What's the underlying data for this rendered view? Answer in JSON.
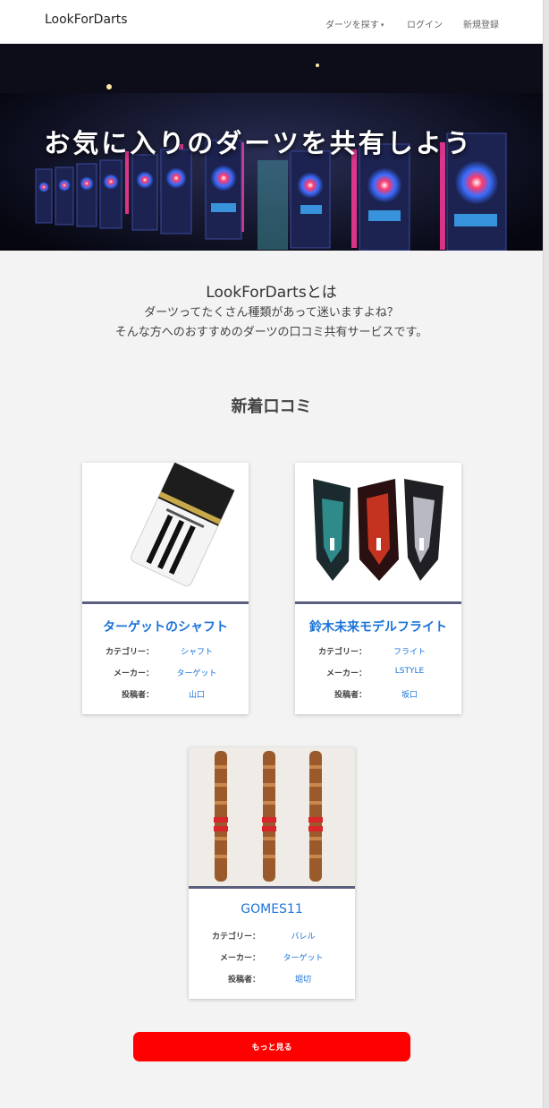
{
  "header": {
    "brand": "LookForDarts",
    "nav": {
      "search": "ダーツを探す",
      "login": "ログイン",
      "signup": "新規登録"
    }
  },
  "hero": {
    "title": "お気に入りのダーツを共有しよう"
  },
  "about": {
    "heading": "LookForDartsとは",
    "line1": "ダーツってたくさん種類があって迷いますよね？",
    "line2": "そんな方へのおすすめのダーツの口コミ共有サービスです。"
  },
  "section": {
    "title": "新着口コミ"
  },
  "labels": {
    "category": "カテゴリー：",
    "maker": "メーカー：",
    "poster": "投稿者："
  },
  "reviews": [
    {
      "title": "ターゲットのシャフト",
      "category": "シャフト",
      "maker": "ターゲット",
      "poster": "山口"
    },
    {
      "title": "鈴木未来モデルフライト",
      "category": "フライト",
      "maker": "LSTYLE",
      "poster": "坂口"
    },
    {
      "title": "GOMES11",
      "category": "バレル",
      "maker": "ターゲット",
      "poster": "堀切"
    }
  ],
  "more_button": "もっと見る",
  "colors": {
    "accent_link": "#1a73d9",
    "button": "#ff0000",
    "card_separator": "#5a5f7e"
  }
}
